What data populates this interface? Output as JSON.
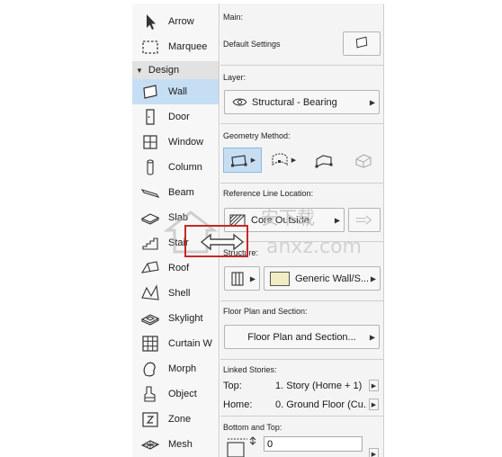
{
  "toolbox": {
    "group_label": "Design",
    "tools_top": [
      {
        "label": "Arrow",
        "icon": "arrow-icon"
      },
      {
        "label": "Marquee",
        "icon": "marquee-icon"
      }
    ],
    "tools": [
      {
        "label": "Wall",
        "icon": "wall-icon",
        "selected": true
      },
      {
        "label": "Door",
        "icon": "door-icon"
      },
      {
        "label": "Window",
        "icon": "window-icon"
      },
      {
        "label": "Column",
        "icon": "column-icon"
      },
      {
        "label": "Beam",
        "icon": "beam-icon"
      },
      {
        "label": "Slab",
        "icon": "slab-icon"
      },
      {
        "label": "Stair",
        "icon": "stair-icon"
      },
      {
        "label": "Roof",
        "icon": "roof-icon"
      },
      {
        "label": "Shell",
        "icon": "shell-icon"
      },
      {
        "label": "Skylight",
        "icon": "skylight-icon"
      },
      {
        "label": "Curtain W",
        "icon": "curtain-wall-icon"
      },
      {
        "label": "Morph",
        "icon": "morph-icon"
      },
      {
        "label": "Object",
        "icon": "object-icon"
      },
      {
        "label": "Zone",
        "icon": "zone-icon"
      },
      {
        "label": "Mesh",
        "icon": "mesh-icon"
      }
    ]
  },
  "panel": {
    "main_label": "Main:",
    "default_settings": "Default Settings",
    "layer_label": "Layer:",
    "layer_value": "Structural - Bearing",
    "geometry_label": "Geometry Method:",
    "reference_label": "Reference Line Location:",
    "reference_value": "Core Outside",
    "structure_label": "Structure:",
    "structure_value": "Generic Wall/S...",
    "floorplan_label": "Floor Plan and Section:",
    "floorplan_value": "Floor Plan and Section...",
    "linked_label": "Linked Stories:",
    "top_key": "Top:",
    "top_value": "1. Story (Home + 1)",
    "home_key": "Home:",
    "home_value": "0. Ground Floor (Cu...",
    "bottom_label": "Bottom and Top:",
    "bottom_value": "0"
  },
  "watermark": {
    "text": "安下载",
    "sub": "anxz.com"
  },
  "colors": {
    "selected_bg": "#c6def4",
    "panel_bg": "#f4f4f4",
    "watermark_box": "#c62828"
  }
}
